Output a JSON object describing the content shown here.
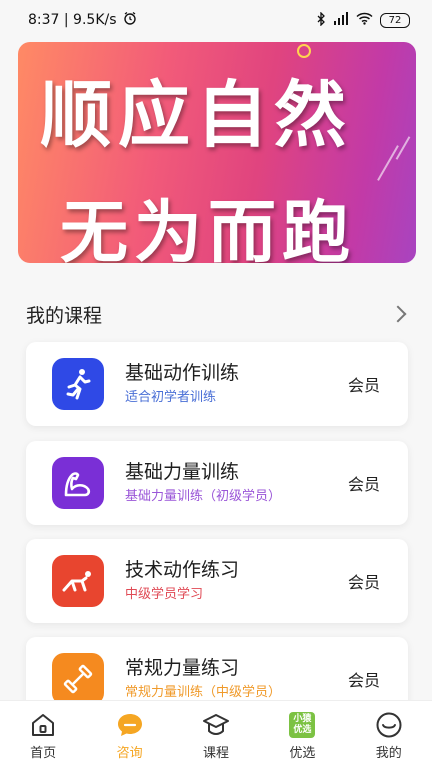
{
  "status_bar": {
    "time_speed": "8:37 | 9.5K/s",
    "battery": "72"
  },
  "banner": {
    "line1": "顺应自然",
    "line2": "无为而跑"
  },
  "section": {
    "title": "我的课程"
  },
  "courses": [
    {
      "name": "基础动作训练",
      "subtitle": "适合初学者训练",
      "badge": "会员",
      "icon": "running-person-icon",
      "icon_color": "#2f49e6",
      "subtitle_color": "#4a6fd6"
    },
    {
      "name": "基础力量训练",
      "subtitle": "基础力量训练（初级学员）",
      "badge": "会员",
      "icon": "flexed-arm-icon",
      "icon_color": "#7a2fd6",
      "subtitle_color": "#9a56d8"
    },
    {
      "name": "技术动作练习",
      "subtitle": "中级学员学习",
      "badge": "会员",
      "icon": "sprint-start-icon",
      "icon_color": "#e8452f",
      "subtitle_color": "#e04a55"
    },
    {
      "name": "常规力量练习",
      "subtitle": "常规力量训练（中级学员）",
      "badge": "会员",
      "icon": "dumbbell-icon",
      "icon_color": "#f58a1f",
      "subtitle_color": "#f09a2a"
    }
  ],
  "nav": {
    "items": [
      {
        "label": "首页",
        "icon": "home-icon"
      },
      {
        "label": "咨询",
        "icon": "chat-bubble-icon",
        "active": true
      },
      {
        "label": "课程",
        "icon": "graduation-cap-icon"
      },
      {
        "label": "优选",
        "icon": "youxuan-badge-icon",
        "badge_line1": "小猿",
        "badge_line2": "优选"
      },
      {
        "label": "我的",
        "icon": "smiley-face-icon"
      }
    ],
    "active_color": "#f5a623"
  }
}
